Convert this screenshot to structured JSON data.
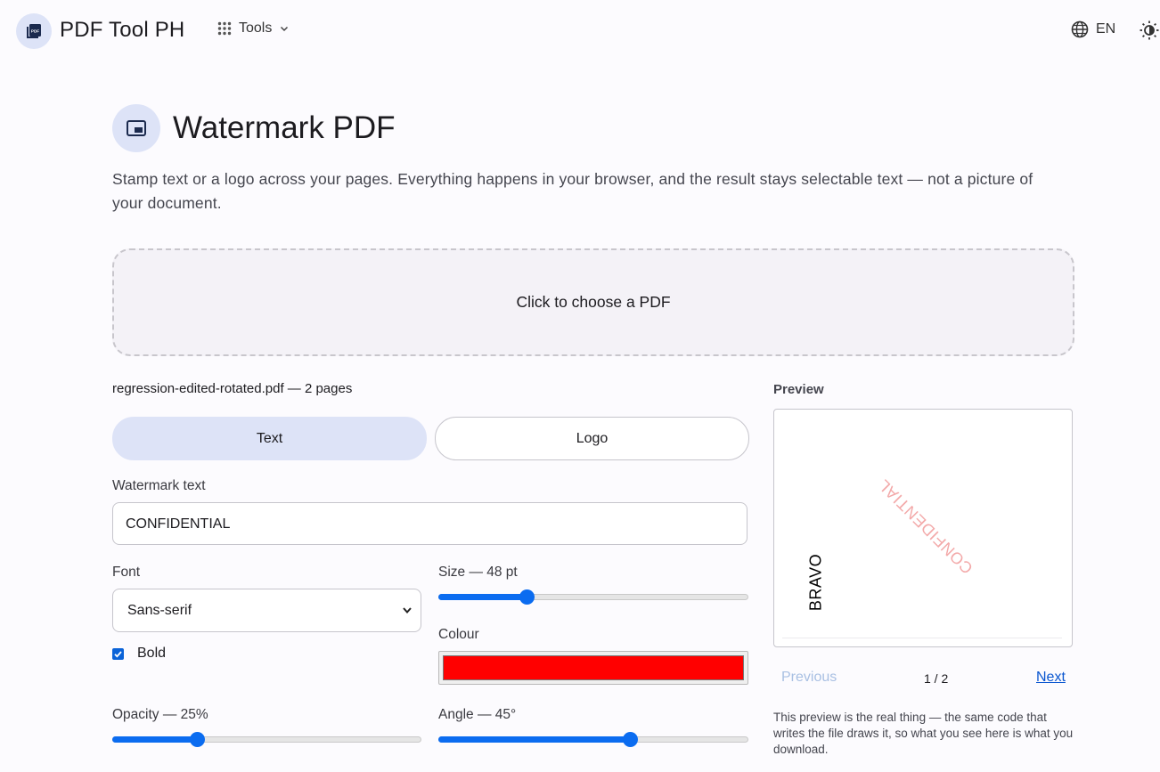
{
  "header": {
    "logo_text": "PDF",
    "app_name": "PDF Tool PH",
    "tools_label": "Tools",
    "language": "EN"
  },
  "page": {
    "title": "Watermark PDF",
    "intro": "Stamp text or a logo across your pages. Everything happens in your browser, and the result stays selectable text — not a picture of your document."
  },
  "dropzone": {
    "label": "Click to choose a PDF"
  },
  "file": {
    "info": "regression-edited-rotated.pdf — 2 pages"
  },
  "mode": {
    "text_label": "Text",
    "logo_label": "Logo",
    "selected": "Text"
  },
  "form": {
    "watermark_text_label": "Watermark text",
    "watermark_text_value": "CONFIDENTIAL",
    "font_label": "Font",
    "font_value": "Sans-serif",
    "bold_label": "Bold",
    "bold_checked": true,
    "size_label": "Size — 48 pt",
    "size_fraction": 0.275,
    "colour_label": "Colour",
    "colour_value": "#ff0000",
    "opacity_label": "Opacity — 25%",
    "opacity_fraction": 0.265,
    "angle_label": "Angle — 45°",
    "angle_fraction": 0.625
  },
  "preview": {
    "label": "Preview",
    "page_text": "BRAVO",
    "watermark_text": "CONFIDENTIAL",
    "previous_label": "Previous",
    "pager": "1 / 2",
    "next_label": "Next",
    "note": "This preview is the real thing — the same code that writes the file draws it, so what you see here is what you download."
  },
  "colors": {
    "accent": "#0b6cf0",
    "tonal": "#dde3f7",
    "watermark": "#f3a9a9"
  },
  "icons": [
    "pdf-file-icon",
    "apps-grid-icon",
    "chevron-down-icon",
    "globe-icon",
    "theme-toggle-icon",
    "picture-in-picture-icon",
    "checkmark-icon"
  ]
}
